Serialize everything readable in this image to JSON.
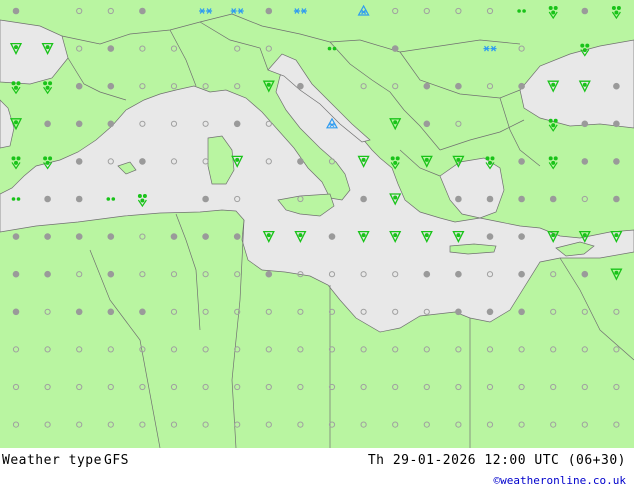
{
  "map": {
    "colors": {
      "land": "#b9f5a1",
      "sea": "#e8e8e8",
      "border": "#707070",
      "dot": "#a0a0a0",
      "cloud": "#9a9a9a",
      "rain": "#19c319",
      "snow": "#2f9cf0"
    },
    "legend_codes": {
      "o": "clear",
      "p": "partly-cloudy",
      "c": "cloudy",
      "r": "rain-light",
      "R": "rain-showers",
      "T": "rain-heavy",
      "D": "drizzle",
      "S": "snow",
      "F": "snow-heavy"
    },
    "rows": [
      "cPoocPSScSPFooooDRcR",
      "TTocooPooPDPcPPSoPRP",
      "RRccooooTcPooccocTTc",
      "TcccooocoPFPTcoPPRcc",
      "RRcocooTocoTRTTRcRcc",
      "DccDRPcoPoPcTPccccoc",
      "ccccocccTTcTTTTccTTT",
      "ccocoooocooooccococT",
      "cocccooooooooocccooo",
      "oooooooooooooooooooo",
      "oooooooooooooooooooo",
      "oooooooooooooooooooo"
    ]
  },
  "footer": {
    "title": "Weather type",
    "model": "GFS",
    "datetime": "Th 29-01-2026 12:00 UTC (06+30)",
    "credit": "©weatheronline.co.uk"
  }
}
